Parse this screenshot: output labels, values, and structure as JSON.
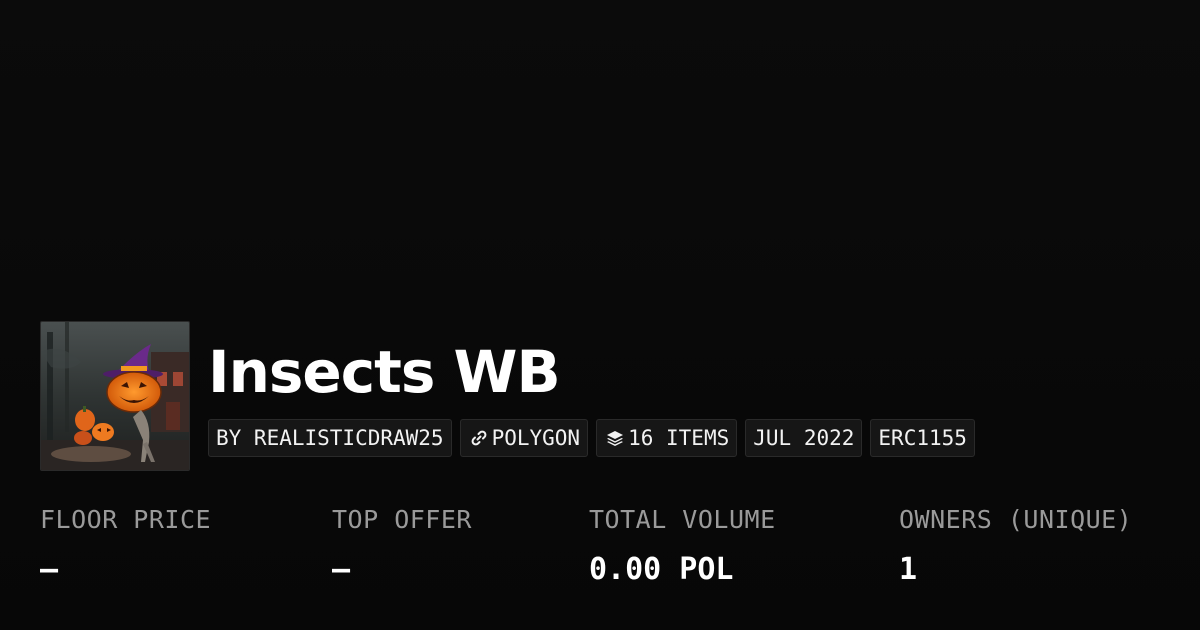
{
  "collection": {
    "title": "Insects WB",
    "thumbnail_icon": "halloween-pumpkin-collection-image"
  },
  "pills": [
    {
      "label": "BY REALISTICDRAW25",
      "icon": ""
    },
    {
      "label": "POLYGON",
      "icon": "link-chain-icon"
    },
    {
      "label": "16 ITEMS",
      "icon": "layers-icon"
    },
    {
      "label": "JUL 2022",
      "icon": ""
    },
    {
      "label": "ERC1155",
      "icon": ""
    }
  ],
  "stats": [
    {
      "label": "FLOOR PRICE",
      "value": "—"
    },
    {
      "label": "TOP OFFER",
      "value": "—"
    },
    {
      "label": "TOTAL VOLUME",
      "value": "0.00 POL"
    },
    {
      "label": "OWNERS (UNIQUE)",
      "value": "1"
    }
  ],
  "colors": {
    "background": "#0a0a0a",
    "pill_background": "#161616",
    "pill_border": "#2a2a2a",
    "label_gray": "#9a9a9a",
    "text": "#ffffff"
  }
}
